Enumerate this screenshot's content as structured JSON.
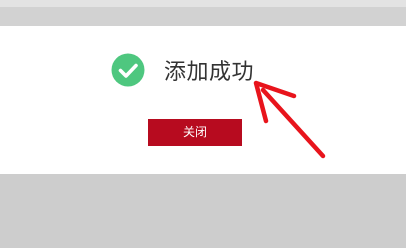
{
  "dialog": {
    "message": "添加成功",
    "close_label": "关闭",
    "success_icon": "check-circle-icon"
  },
  "colors": {
    "success_green": "#4ec77f",
    "button_red": "#b70b1f",
    "annotation_red": "#e8141c",
    "overlay_gray": "#cdcdcd"
  },
  "annotation": {
    "type": "arrow",
    "points_to": "message"
  }
}
